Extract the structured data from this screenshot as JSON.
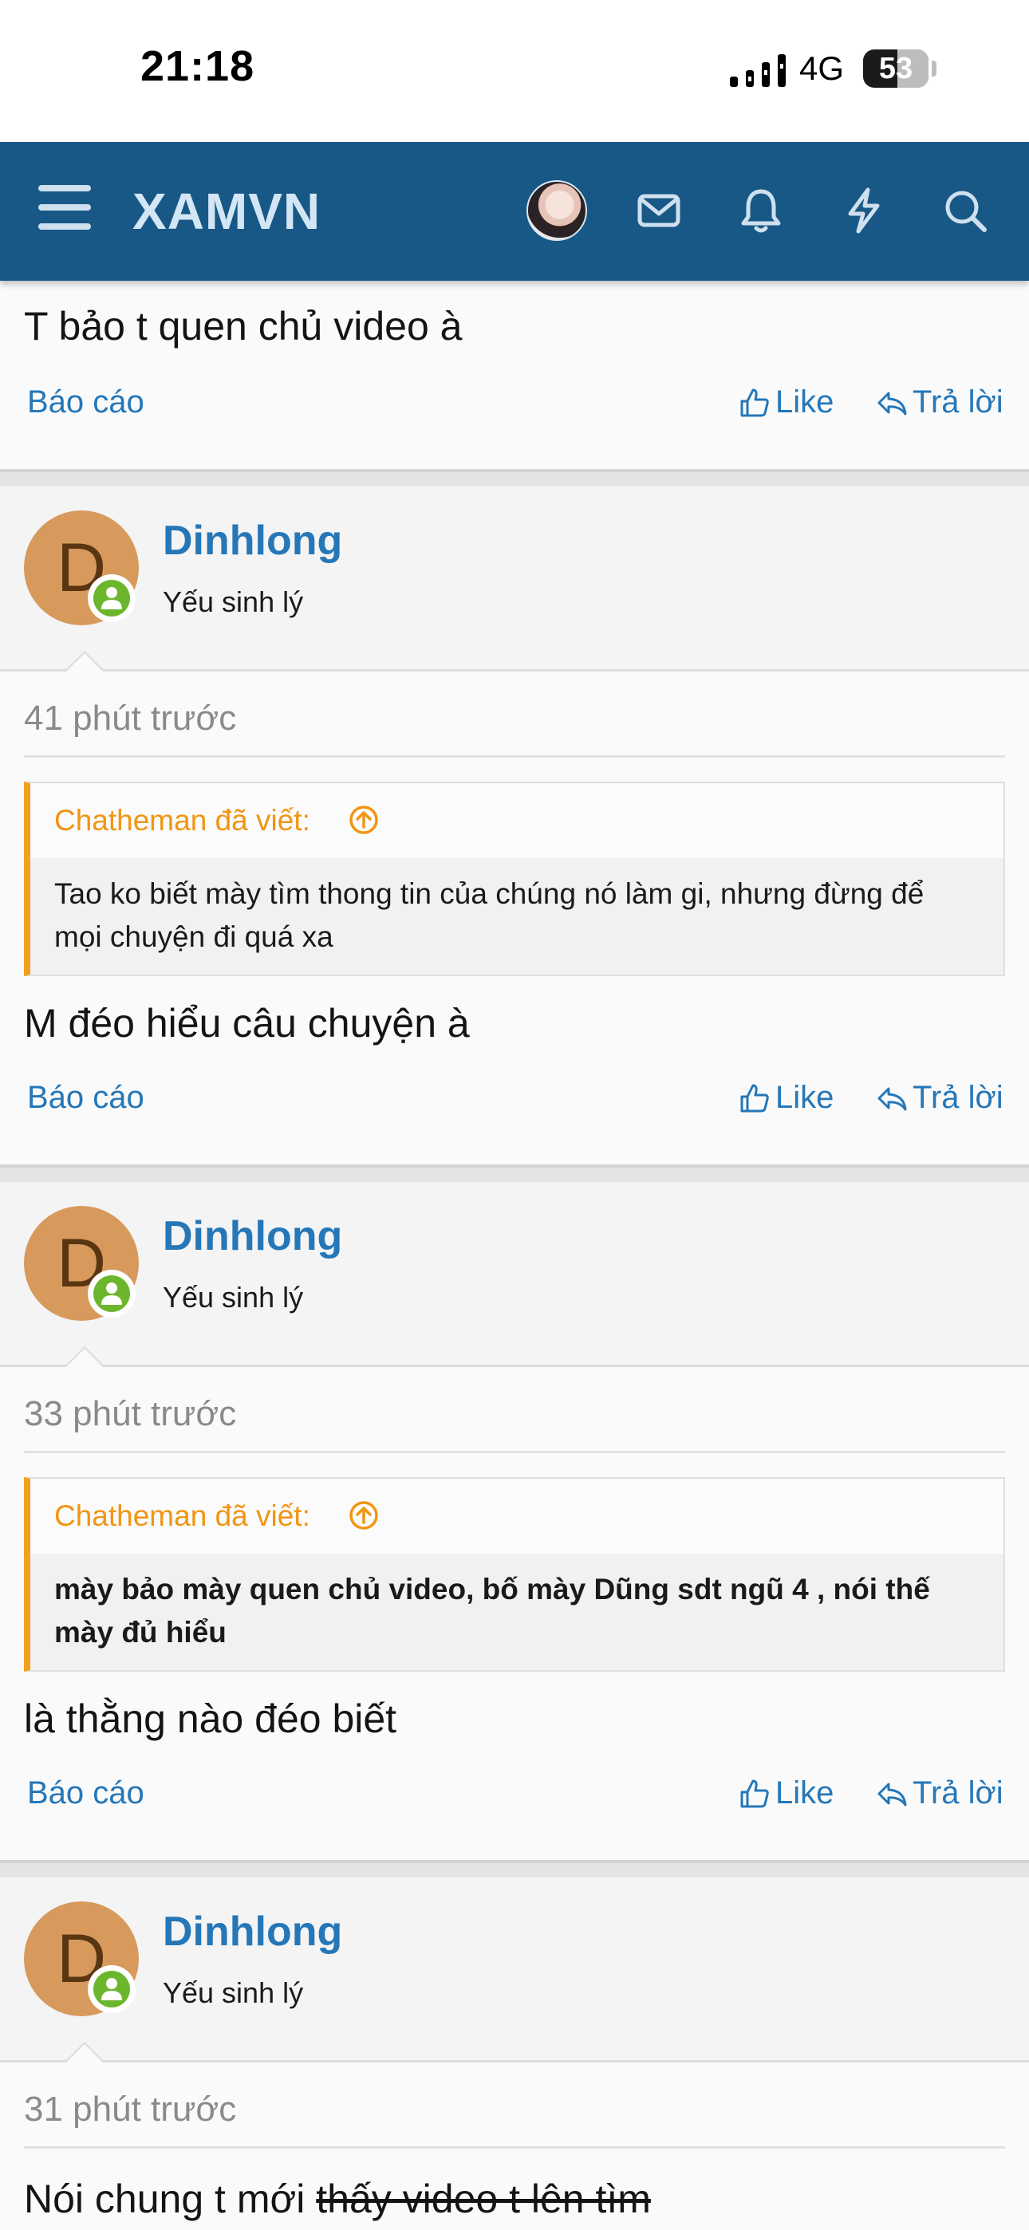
{
  "status_bar": {
    "time": "21:18",
    "network": "4G",
    "battery": "53",
    "battery_level": 0.53
  },
  "nav": {
    "logo": "XAMVN",
    "icons": [
      "menu-icon",
      "avatar",
      "mail-icon",
      "bell-icon",
      "bolt-icon",
      "search-icon"
    ]
  },
  "post0": {
    "text": "T bảo t quen chủ video à",
    "report": "Báo cáo",
    "like": "Like",
    "reply": "Trả lời"
  },
  "posts": [
    {
      "avatar_letter": "D",
      "username": "Dinhlong",
      "user_title": "Yếu sinh lý",
      "time": "41 phút trước",
      "quote_author": "Chatheman đã viết:",
      "quote_text": "Tao ko biết mày tìm thong tin của chúng nó làm gi, nhưng đừng để mọi chuyện đi quá xa",
      "text": "M đéo hiểu câu chuyện à",
      "report": "Báo cáo",
      "like": "Like",
      "reply": "Trả lời"
    },
    {
      "avatar_letter": "D",
      "username": "Dinhlong",
      "user_title": "Yếu sinh lý",
      "time": "33 phút trước",
      "quote_author": "Chatheman đã viết:",
      "quote_text": "mày bảo mày quen chủ video, bố mày Dũng sdt ngũ 4 , nói thế mày đủ hiểu",
      "text": "là thằng nào đéo biết",
      "report": "Báo cáo",
      "like": "Like",
      "reply": "Trả lời"
    },
    {
      "avatar_letter": "D",
      "username": "Dinhlong",
      "user_title": "Yếu sinh lý",
      "time": "31 phút trước",
      "text_plain": "Nói chung t mới ",
      "text_struck": "thấy video t lên tìm"
    }
  ],
  "colors": {
    "nav_bg": "#185886",
    "link": "#2577b8",
    "quote_accent": "#f3a01e",
    "online": "#6cb62e",
    "avatar_bg": "#d79a5c"
  }
}
